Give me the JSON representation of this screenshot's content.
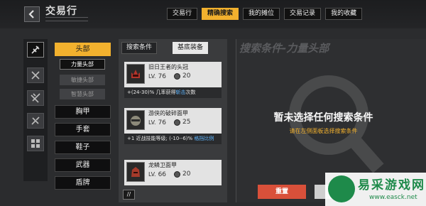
{
  "header": {
    "title": "交易行",
    "tabs": [
      {
        "label": "交易行",
        "active": false
      },
      {
        "label": "精确搜索",
        "active": true
      },
      {
        "label": "我的摊位",
        "active": false
      },
      {
        "label": "交易记录",
        "active": false
      },
      {
        "label": "我的收藏",
        "active": false
      }
    ]
  },
  "categories": {
    "main": [
      {
        "label": "头部",
        "active": true
      },
      {
        "label": "胸甲",
        "active": false
      },
      {
        "label": "手套",
        "active": false
      },
      {
        "label": "鞋子",
        "active": false
      },
      {
        "label": "武器",
        "active": false
      },
      {
        "label": "盾牌",
        "active": false
      }
    ],
    "sub": [
      {
        "label": "力量头部",
        "active": true
      },
      {
        "label": "敏捷头部",
        "active": false
      },
      {
        "label": "智慧头部",
        "active": false
      }
    ]
  },
  "results": {
    "tabs": [
      {
        "label": "搜索条件",
        "active": false
      },
      {
        "label": "基底装备",
        "active": true
      }
    ],
    "items": [
      {
        "name": "旧日王者的头冠",
        "lv_label": "LV.",
        "lv": "76",
        "cost": "20",
        "affix_pre": "+(24-30)% 几率获得",
        "affix_hl": "斩击",
        "affix_post": "次数",
        "icon": "crown-helmet-icon"
      },
      {
        "name": "游侠的破碎面甲",
        "lv_label": "LV.",
        "lv": "76",
        "cost": "25",
        "affix_pre": "+1 近战技能等级; (-10--6)% ",
        "affix_hl": "格挡比例",
        "affix_post": "",
        "icon": "visor-helmet-icon"
      },
      {
        "name": "龙鳞卫面甲",
        "lv_label": "LV.",
        "lv": "66",
        "cost": "20",
        "affix_pre": "",
        "affix_hl": "",
        "affix_post": "",
        "icon": "dragon-helmet-icon"
      }
    ],
    "scroll_label": "//"
  },
  "condition": {
    "title": "搜索条件-力量头部",
    "message": "暂未选择任何搜索条件",
    "hint": "请在左侧面板选择搜索条件",
    "reset_label": "重置"
  },
  "watermark": {
    "text": "易采游戏网",
    "url": "www.easck.net"
  },
  "colors": {
    "accent": "#f2b12e",
    "reset": "#d9503a",
    "highlight": "#5fb6ff"
  }
}
